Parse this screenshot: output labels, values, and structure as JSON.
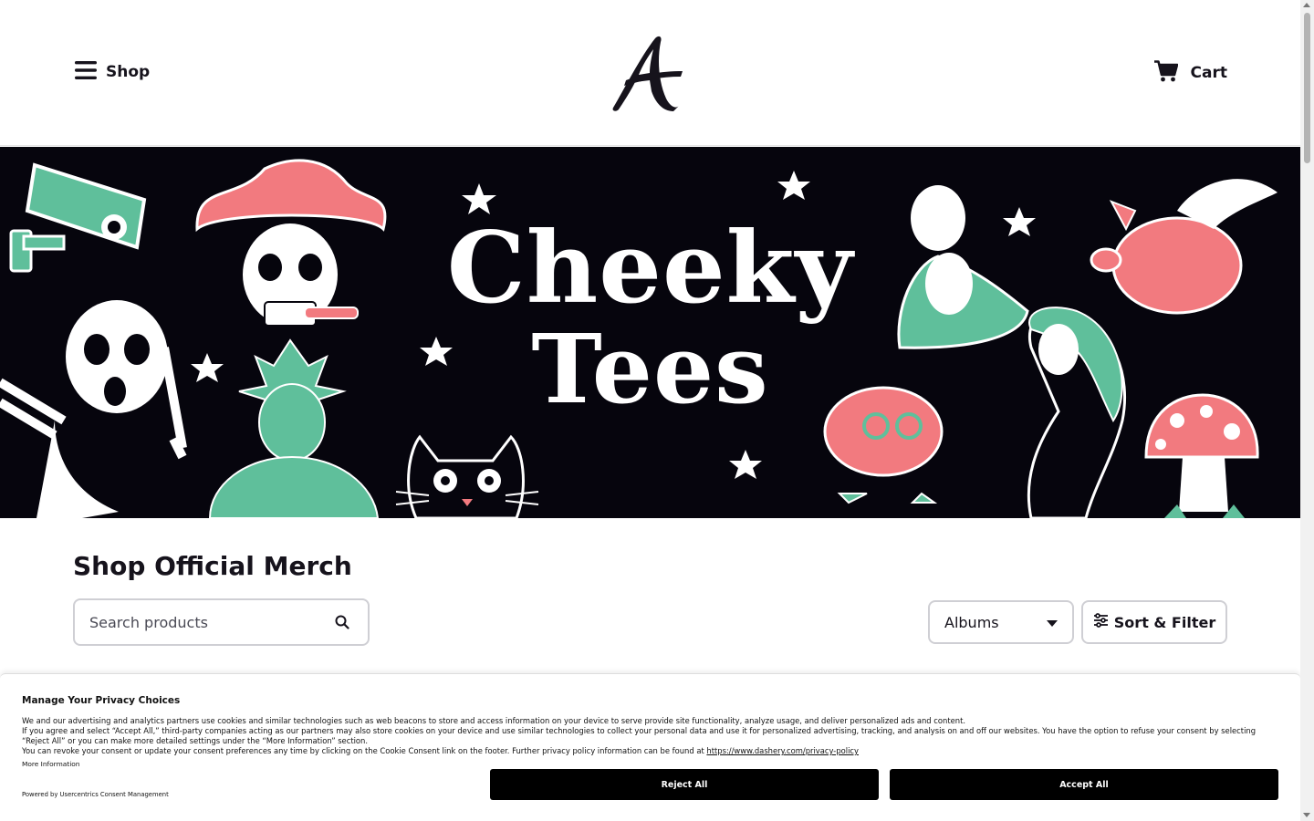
{
  "header": {
    "menu_label": "Shop",
    "cart_label": "Cart",
    "logo_letter": "A"
  },
  "banner": {
    "line1": "Cheeky",
    "line2": "Tees",
    "colors": {
      "background": "#06050d",
      "pink": "#f27a7f",
      "green": "#5fbf9b"
    }
  },
  "main": {
    "title": "Shop Official Merch",
    "search": {
      "placeholder": "Search products",
      "value": ""
    },
    "category_select": {
      "selected": "Albums"
    },
    "filter_button": "Sort & Filter"
  },
  "consent": {
    "title": "Manage Your Privacy Choices",
    "p1": "We and our advertising and analytics partners use cookies and similar technologies such as web beacons to store and access information on your device to serve provide site functionality, analyze usage, and deliver personalized ads and content.",
    "p2": "If you agree and select “Accept All,” third-party companies acting as our partners may also store cookies on your device and use similar technologies to collect your personal data and use it for personalized advertising, tracking, and analysis on and off our websites. You have the option to refuse your consent by selecting “Reject All” or you can make more detailed settings under the “More Information” section.",
    "p3": "You can revoke your consent or update your consent preferences any time by clicking on the Cookie Consent link on the footer. Further privacy policy information can be found at",
    "policy_link": "https://www.dashery.com/privacy-policy",
    "more_info": "More Information",
    "powered_by": "Powered by Usercentrics Consent Management",
    "reject_label": "Reject All",
    "accept_label": "Accept All"
  }
}
